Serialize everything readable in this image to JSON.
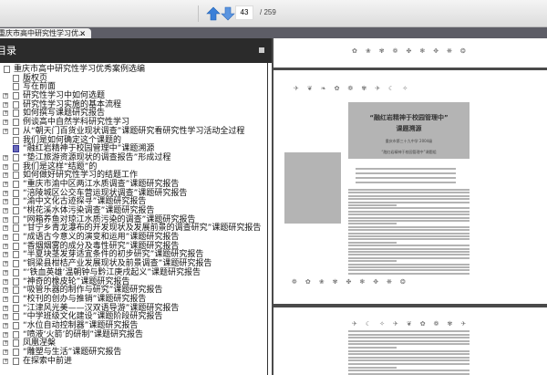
{
  "toolbar": {
    "page_current": "43",
    "page_total": "/ 259",
    "prev_icon": "arrow-up-icon",
    "next_icon": "arrow-down-icon"
  },
  "tab": {
    "title": "重庆市高中研究性学习优...",
    "close": "×"
  },
  "outline": {
    "title": "目录",
    "items": [
      {
        "label": "重庆市高中研究性学习优秀案例选编",
        "level": 0,
        "expandable": false
      },
      {
        "label": "版权页",
        "level": 1,
        "expandable": false
      },
      {
        "label": "写在前面",
        "level": 1,
        "expandable": false
      },
      {
        "label": "研究性学习中如何选题",
        "level": 1,
        "expandable": true
      },
      {
        "label": "研究性学习实施的基本流程",
        "level": 1,
        "expandable": true
      },
      {
        "label": "如何撰写课题研究报告",
        "level": 1,
        "expandable": true
      },
      {
        "label": "例谈高中自然学科研究性学习",
        "level": 1,
        "expandable": true
      },
      {
        "label": "从“朝天门百货业现状调查”课题研究看研究性学习活动全过程",
        "level": 1,
        "expandable": true
      },
      {
        "label": "我们是如何确定这个课题的",
        "level": 1,
        "expandable": false
      },
      {
        "label": "“融红岩精神于校园管理中”课题溯源",
        "level": 1,
        "expandable": false,
        "selected": true
      },
      {
        "label": "“垫江旅游资源现状的调查报告”形成过程",
        "level": 1,
        "expandable": true
      },
      {
        "label": "我们是这样“结题”的",
        "level": 1,
        "expandable": true
      },
      {
        "label": "如何做好研究性学习的结题工作",
        "level": 1,
        "expandable": true
      },
      {
        "label": "“重庆市渝中区两江水质调查”课题研究报告",
        "level": 1,
        "expandable": true
      },
      {
        "label": "“涪陵城区公交车营运现状调查”课题研究报告",
        "level": 1,
        "expandable": true
      },
      {
        "label": "“渝中文化古迹探寻”课题研究报告",
        "level": 1,
        "expandable": true
      },
      {
        "label": "“桃花溪水体污染调查”课题研究报告",
        "level": 1,
        "expandable": true
      },
      {
        "label": "“网箱养鱼对琼江水质污染的调查”课题研究报告",
        "level": 1,
        "expandable": true
      },
      {
        "label": "“甘宁乡青龙瀑布的开发现状及发展前景的调查研究”课题研究报告",
        "level": 1,
        "expandable": true
      },
      {
        "label": "“成语古今意义的演变和运用”课题研究报告",
        "level": 1,
        "expandable": true
      },
      {
        "label": "“香烟烟雾的成分及毒性研究”课题研究报告",
        "level": 1,
        "expandable": true
      },
      {
        "label": "“半夏块茎发芽适宜条件的初步研究”课题研究报告",
        "level": 1,
        "expandable": true
      },
      {
        "label": "“铜梁县柑桔产业发展现状及前景调查”课题研究报告",
        "level": 1,
        "expandable": true
      },
      {
        "label": "“‘铁血英雄’温朝钟与黔江庚戌起义”课题研究报告",
        "level": 1,
        "expandable": true
      },
      {
        "label": "“神奇的橡皮轮”课题研究报告",
        "level": 1,
        "expandable": true
      },
      {
        "label": "“吸管乐器的制作与研究”课题研究报告",
        "level": 1,
        "expandable": true
      },
      {
        "label": "“校刊的创办与推销”课题研究报告",
        "level": 1,
        "expandable": true
      },
      {
        "label": "“江津风光美——汉双语导游”课题研究报告",
        "level": 1,
        "expandable": true
      },
      {
        "label": "“中学班级文化建设”课题阶段研究报告",
        "level": 1,
        "expandable": true
      },
      {
        "label": "“水位自动控制器”课题研究报告",
        "level": 1,
        "expandable": true
      },
      {
        "label": "“喷液‘火箭’的研制”课题研究报告",
        "level": 1,
        "expandable": true
      },
      {
        "label": "凤凰涅槃",
        "level": 1,
        "expandable": true
      },
      {
        "label": "“雕塑与生活”课题研究报告",
        "level": 1,
        "expandable": true
      },
      {
        "label": "在探索中前进",
        "level": 1,
        "expandable": true
      }
    ]
  },
  "page": {
    "title_line1": "“融红岩精神于校园管理中”",
    "title_line2": "课题溯源",
    "byline1": "重庆市第三十九中学 2004级",
    "byline2": "“融红岩精神于校园管理中”课题组"
  }
}
